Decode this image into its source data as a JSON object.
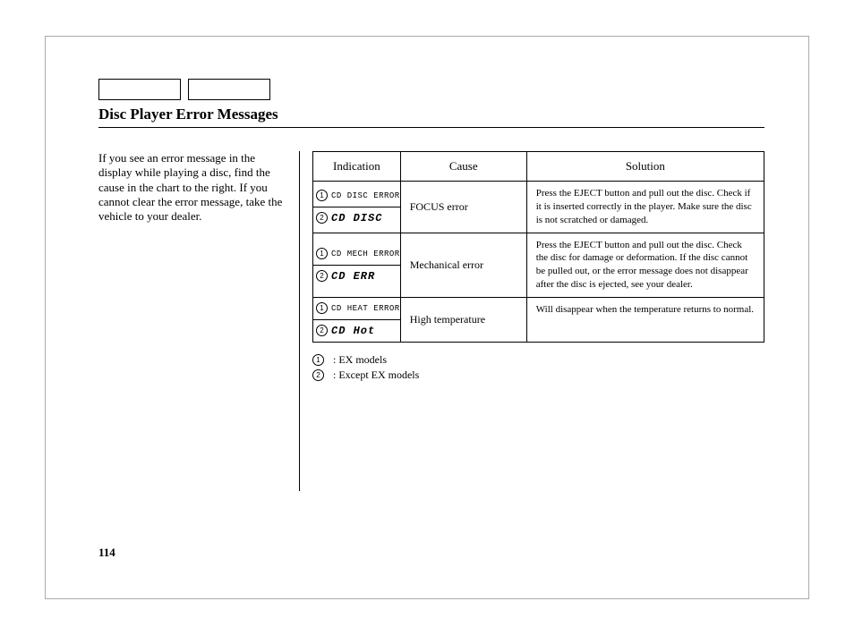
{
  "title": "Disc Player Error Messages",
  "intro": "If you see an error message in the display while playing a disc, find the cause in the chart to the right. If you cannot clear the error message, take the vehicle to your dealer.",
  "table": {
    "headers": {
      "indication": "Indication",
      "cause": "Cause",
      "solution": "Solution"
    },
    "rows": [
      {
        "ind1_mark": "1",
        "ind1_text": "CD   DISC ERROR",
        "ind2_mark": "2",
        "ind2_text": "CD   DISC",
        "cause": "FOCUS error",
        "solution": "Press the EJECT button and pull out the disc. Check if it is inserted correctly in the player. Make sure the disc is not scratched or damaged."
      },
      {
        "ind1_mark": "1",
        "ind1_text": "CD   MECH ERROR",
        "ind2_mark": "2",
        "ind2_text": "CD   ERR",
        "cause": "Mechanical error",
        "solution": "Press the EJECT button and pull out the disc. Check the disc for damage or deformation. If the disc cannot be pulled out, or the error message does not disappear after the disc is ejected, see your dealer."
      },
      {
        "ind1_mark": "1",
        "ind1_text": "CD   HEAT ERROR",
        "ind2_mark": "2",
        "ind2_text": "CD   Hot",
        "cause": "High temperature",
        "solution": "Will disappear when the temperature returns to normal."
      }
    ]
  },
  "legend": {
    "m1": "1",
    "t1": ":  EX models",
    "m2": "2",
    "t2": ":  Except EX models"
  },
  "page_number": "114"
}
